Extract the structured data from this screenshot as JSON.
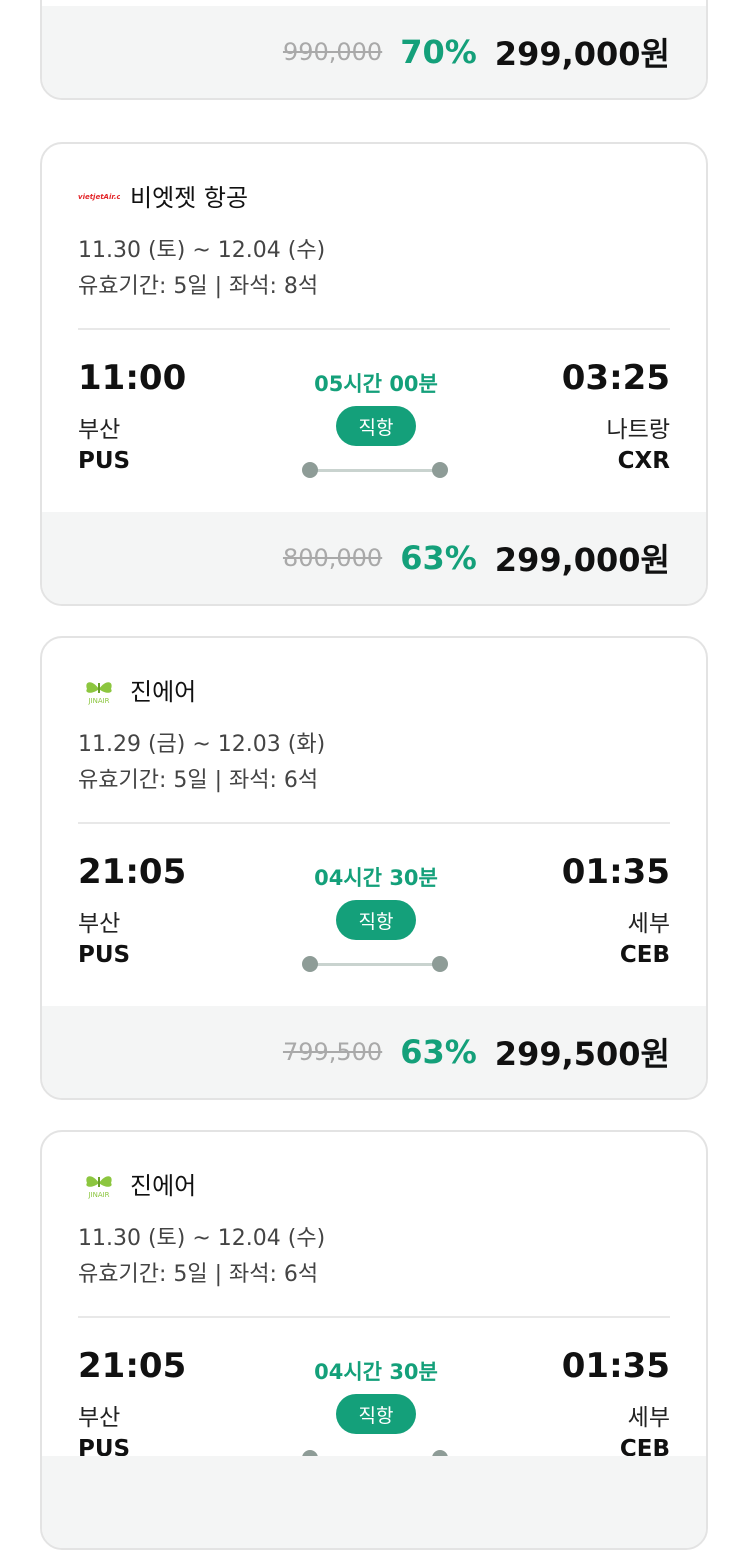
{
  "prev_card": {
    "original_price": "990,000",
    "discount": "70%",
    "final_price": "299,000원"
  },
  "cards": [
    {
      "airline": {
        "name": "비엣젯 항공",
        "logo_icon": "vietjet-logo-icon",
        "logo_text": "vietjetAir.com"
      },
      "dates": "11.30 (토) ~ 12.04 (수)",
      "validity": "유효기간: 5일 | 좌석: 8석",
      "departure": {
        "time": "11:00",
        "city": "부산",
        "code": "PUS"
      },
      "arrival": {
        "time": "03:25",
        "city": "나트랑",
        "code": "CXR"
      },
      "duration": "05시간 00분",
      "flight_type": "직항",
      "price": {
        "original": "800,000",
        "discount": "63%",
        "final": "299,000원"
      }
    },
    {
      "airline": {
        "name": "진에어",
        "logo_icon": "jinair-logo-icon",
        "logo_text": "JINAIR"
      },
      "dates": "11.29 (금) ~ 12.03 (화)",
      "validity": "유효기간: 5일 | 좌석: 6석",
      "departure": {
        "time": "21:05",
        "city": "부산",
        "code": "PUS"
      },
      "arrival": {
        "time": "01:35",
        "city": "세부",
        "code": "CEB"
      },
      "duration": "04시간 30분",
      "flight_type": "직항",
      "price": {
        "original": "799,500",
        "discount": "63%",
        "final": "299,500원"
      }
    },
    {
      "airline": {
        "name": "진에어",
        "logo_icon": "jinair-logo-icon",
        "logo_text": "JINAIR"
      },
      "dates": "11.30 (토) ~ 12.04 (수)",
      "validity": "유효기간: 5일 | 좌석: 6석",
      "departure": {
        "time": "21:05",
        "city": "부산",
        "code": "PUS"
      },
      "arrival": {
        "time": "01:35",
        "city": "세부",
        "code": "CEB"
      },
      "duration": "04시간 30분",
      "flight_type": "직항"
    }
  ],
  "colors": {
    "accent": "#14a07a",
    "vietjet_red": "#e3262a",
    "jinair_green": "#8cc63f"
  }
}
